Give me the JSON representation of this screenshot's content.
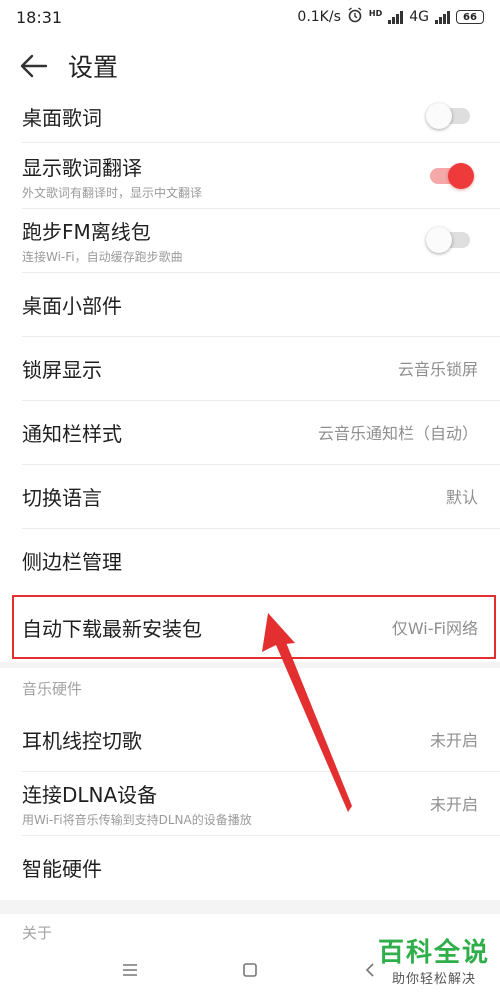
{
  "status_bar": {
    "time": "18:31",
    "net_speed": "0.1K/s",
    "hd_badge": "HD",
    "network": "4G",
    "battery": "66",
    "icons": [
      "alarm-icon",
      "signal-icon",
      "battery-icon"
    ]
  },
  "header": {
    "title": "设置",
    "back_icon": "arrow-left-icon"
  },
  "settings": {
    "items": [
      {
        "label": "桌面歌词",
        "type": "toggle",
        "on": false
      },
      {
        "label": "显示歌词翻译",
        "sub": "外文歌词有翻译时，显示中文翻译",
        "type": "toggle",
        "on": true
      },
      {
        "label": "跑步FM离线包",
        "sub": "连接Wi-Fi，自动缓存跑步歌曲",
        "type": "toggle",
        "on": false
      },
      {
        "label": "桌面小部件"
      },
      {
        "label": "锁屏显示",
        "value": "云音乐锁屏"
      },
      {
        "label": "通知栏样式",
        "value": "云音乐通知栏（自动）"
      },
      {
        "label": "切换语言",
        "value": "默认"
      },
      {
        "label": "侧边栏管理"
      },
      {
        "label": "自动下载最新安装包",
        "value": "仅Wi-Fi网络"
      }
    ]
  },
  "music_hardware": {
    "header": "音乐硬件",
    "items": [
      {
        "label": "耳机线控切歌",
        "value": "未开启"
      },
      {
        "label": "连接DLNA设备",
        "sub": "用Wi-Fi将音乐传输到支持DLNA的设备播放",
        "value": "未开启"
      },
      {
        "label": "智能硬件"
      }
    ]
  },
  "about": {
    "header": "关于"
  },
  "nav_bar": {
    "icons": [
      "menu-icon",
      "home-square-icon",
      "back-chevron-icon"
    ]
  },
  "watermark": {
    "main": "百科全说",
    "sub": "助你轻松解决"
  },
  "colors": {
    "accent": "#ee3a3a",
    "annotation": "#e32f2f",
    "watermark_green": "#2fae4a"
  }
}
